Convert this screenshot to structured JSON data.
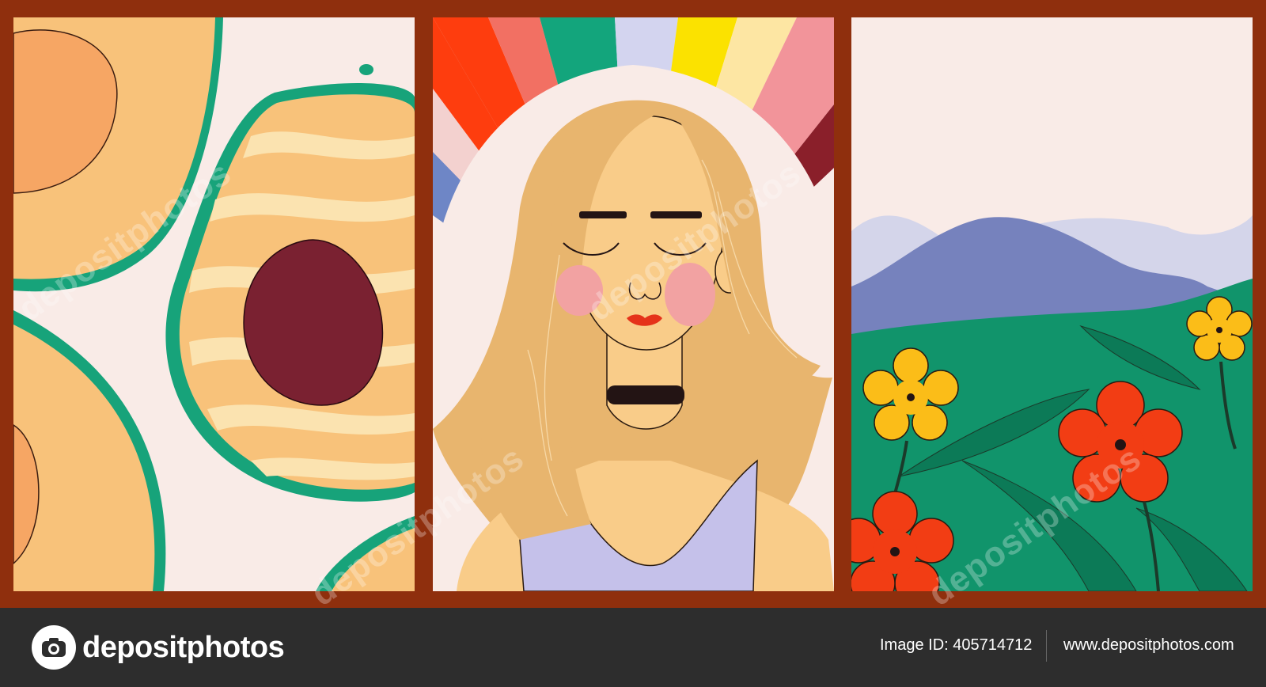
{
  "watermark": {
    "text": "depositphotos"
  },
  "panels": [
    {
      "subject": "avocado"
    },
    {
      "subject": "woman-with-rainbow"
    },
    {
      "subject": "mountain-flower-field"
    }
  ],
  "colors": {
    "frame": "#8f2f0d",
    "footer_background": "#2d2d2d",
    "avocado_flesh": "#f8c27a",
    "avocado_skin_outline": "#17a37a",
    "avocado_pit": "#7a2131",
    "paper": "#f9ebe7",
    "hair": "#e8b56e",
    "skin": "#f9cc89",
    "top": "#c5c1ea",
    "mountain": "#7682bd",
    "field": "#11946b",
    "flower_red": "#f23d14",
    "flower_yellow": "#fbbd18"
  },
  "footer": {
    "logo_icon": "camera-icon",
    "logo_text": "depositphotos",
    "image_id": "Image ID: 405714712",
    "site_url": "www.depositphotos.com"
  }
}
